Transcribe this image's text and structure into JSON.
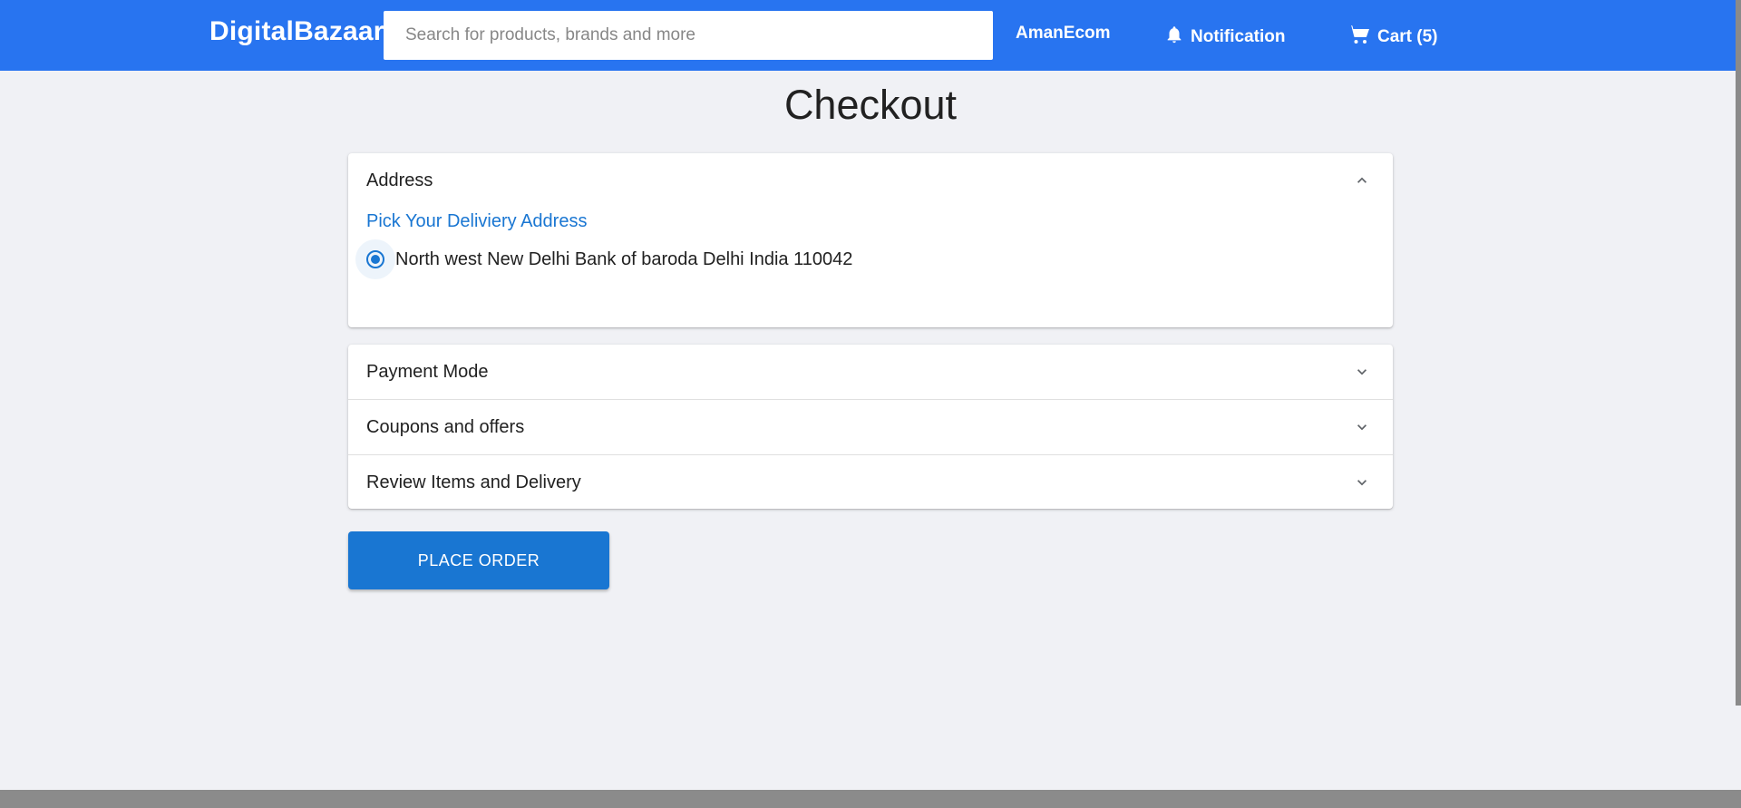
{
  "header": {
    "brand": "DigitalBazaar",
    "search_placeholder": "Search for products, brands and more",
    "user_label": "AmanEcom",
    "notification_label": "Notification",
    "cart_label": "Cart (5)",
    "bell_icon": "bell-icon",
    "cart_icon": "cart-icon",
    "background_color": "#2874f0"
  },
  "page_title": "Checkout",
  "address_section": {
    "title": "Address",
    "expanded": true,
    "pick_label": "Pick Your Deliviery Address",
    "addresses": [
      {
        "label": "North west New Delhi Bank of baroda Delhi India 110042",
        "selected": true
      }
    ],
    "chevron_icon": "chevron-up-icon"
  },
  "sections": [
    {
      "title": "Payment Mode",
      "expanded": false
    },
    {
      "title": "Coupons and offers",
      "expanded": false
    },
    {
      "title": "Review Items and Delivery",
      "expanded": false
    }
  ],
  "place_order_label": "PLACE ORDER",
  "accent_color": "#1976d2"
}
